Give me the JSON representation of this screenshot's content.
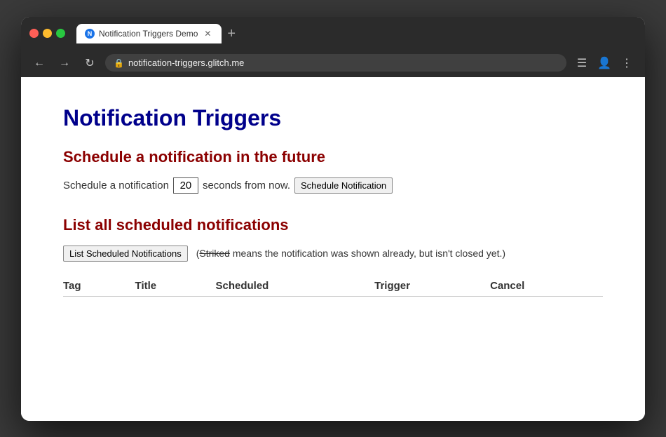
{
  "browser": {
    "tab_title": "Notification Triggers Demo",
    "url": "notification-triggers.glitch.me",
    "new_tab_icon": "+"
  },
  "nav": {
    "back_icon": "←",
    "forward_icon": "→",
    "refresh_icon": "↻",
    "lock_icon": "🔒",
    "menu_icon": "☰",
    "account_icon": "👤",
    "more_icon": "⋮"
  },
  "page": {
    "title": "Notification Triggers",
    "section1_title": "Schedule a notification in the future",
    "schedule_prefix": "Schedule a notification",
    "schedule_value": "20",
    "schedule_suffix": "seconds from now.",
    "schedule_btn": "Schedule Notification",
    "section2_title": "List all scheduled notifications",
    "list_btn": "List Scheduled Notifications",
    "list_note_prefix": "(",
    "list_note_striked": "Striked",
    "list_note_suffix": " means the notification was shown already, but isn't closed yet.)",
    "table_headers": [
      "Tag",
      "Title",
      "Scheduled",
      "Trigger",
      "Cancel"
    ],
    "table_rows": []
  }
}
